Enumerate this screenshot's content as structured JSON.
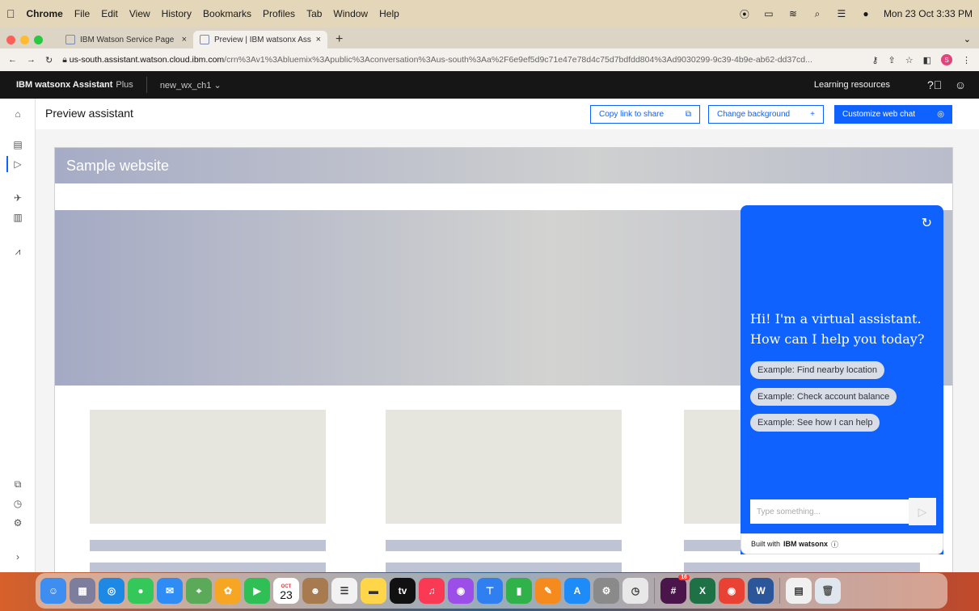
{
  "menubar": {
    "app": "Chrome",
    "menus": [
      "File",
      "Edit",
      "View",
      "History",
      "Bookmarks",
      "Profiles",
      "Tab",
      "Window",
      "Help"
    ],
    "clock": "Mon 23 Oct  3:33 PM",
    "icons": [
      "record-icon",
      "battery-icon",
      "wifi-icon",
      "search-icon",
      "control-center-icon",
      "siri-icon"
    ]
  },
  "tabs": [
    {
      "title": "IBM Watson Service Page",
      "close": "×"
    },
    {
      "title": "Preview | IBM watsonx Assista",
      "close": "×"
    }
  ],
  "tabbar": {
    "new_tab": "+",
    "menu": "⌄"
  },
  "address": {
    "host": "us-south.assistant.watson.cloud.ibm.com",
    "path": "/crn%3Av1%3Abluemix%3Apublic%3Aconversation%3Aus-south%3Aa%2F6e9ef5d9c71e47e78d4c75d7bdfdd804%3Ad9030299-9c39-4b9e-ab62-dd37cd...",
    "profile_initial": "S"
  },
  "header": {
    "brand_strong": "IBM watsonx Assistant",
    "brand_plan": "Plus",
    "assistant_name": "new_wx_ch1",
    "learning": "Learning resources"
  },
  "toolbar": {
    "title": "Preview assistant",
    "copy_link": "Copy link to share",
    "change_bg": "Change background",
    "change_bg_icon": "+",
    "customize": "Customize web chat"
  },
  "sample": {
    "title": "Sample website"
  },
  "chat": {
    "greeting": "Hi! I'm a virtual assistant. How can I help you today?",
    "chips": [
      "Example: Find nearby location",
      "Example: Check account balance",
      "Example: See how I can help"
    ],
    "placeholder": "Type something...",
    "footer_prefix": "Built with",
    "footer_brand": "IBM watsonx",
    "footer_info": "ⓘ"
  },
  "dock": {
    "calendar_month": "OCT",
    "calendar_day": "23",
    "slack_badge": "16"
  },
  "colors": {
    "accent": "#0f62fe",
    "header_bg": "#161616",
    "chip_bg": "#d9dde6"
  }
}
